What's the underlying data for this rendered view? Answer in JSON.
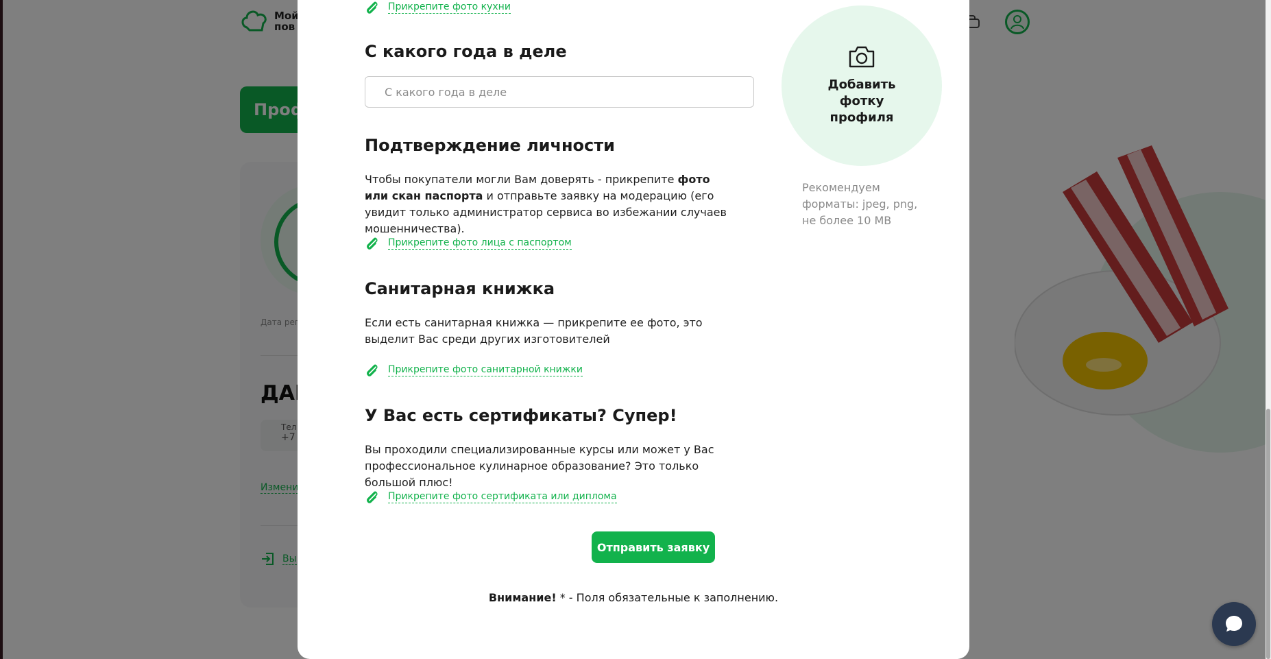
{
  "background": {
    "logo_text_line1": "Мой",
    "logo_text_line2": "пов",
    "green_button_label": "Проф",
    "reg_date_label": "Дата рег",
    "data_heading": "ДАН",
    "phone_label": "Тел",
    "phone_value": "+7",
    "change_link": "Измени",
    "exit_link": "Вы"
  },
  "modal": {
    "kitchen_attach_link": "Прикрепите фото кухни",
    "year_section": {
      "title": "С какого года в деле",
      "input_placeholder": "С какого года в деле",
      "input_value": ""
    },
    "identity_section": {
      "title": "Подтверждение личности",
      "text_part1": "Чтобы покупатели могли Вам доверять - прикрепите ",
      "text_bold": "фото или скан паспорта",
      "text_part2": " и отправьте заявку на модерацию (его увидит только администратор сервиса во избежании случаев мошенничества).",
      "attach_link": "Прикрепите фото лица с паспортом"
    },
    "sanitary_section": {
      "title": "Санитарная книжка",
      "text": "Если есть санитарная книжка — прикрепите ее фото, это выделит Вас среди других изготовителей",
      "attach_link": "Прикрепите фото санитарной книжки"
    },
    "certificates_section": {
      "title": "У Вас есть сертификаты? Супер!",
      "text": "Вы проходили специализированные курсы или может у Вас профессиональное кулинарное образование? Это только большой плюс!",
      "attach_link": "Прикрепите фото сертификата или диплома"
    },
    "profile_photo": {
      "label": "Добавить фотку профиля",
      "formats_note": "Рекомендуем форматы: jpeg, png, не более 10 MB"
    },
    "submit_label": "Отправить заявку",
    "note_bold": "Внимание!",
    "note_text": " * - Поля обязательные к заполнению."
  },
  "colors": {
    "accent": "#12b24c",
    "photo_circle_bg": "#e6f7ec",
    "chat_button_bg": "#2b3950"
  },
  "icons": {
    "attach": "paperclip-icon",
    "camera": "camera-icon",
    "chat": "chat-bubble-icon"
  }
}
